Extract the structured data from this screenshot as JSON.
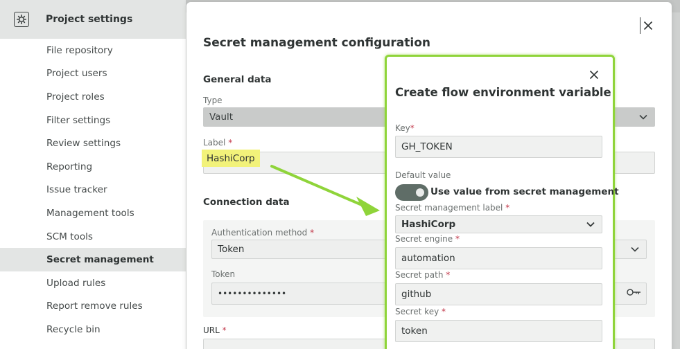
{
  "sidebar": {
    "title": "Project settings",
    "items": [
      {
        "label": "File repository"
      },
      {
        "label": "Project users"
      },
      {
        "label": "Project roles"
      },
      {
        "label": "Filter settings"
      },
      {
        "label": "Review settings"
      },
      {
        "label": "Reporting"
      },
      {
        "label": "Issue tracker"
      },
      {
        "label": "Management tools"
      },
      {
        "label": "SCM tools"
      },
      {
        "label": "Secret management",
        "active": true
      },
      {
        "label": "Upload rules"
      },
      {
        "label": "Report remove rules"
      },
      {
        "label": "Recycle bin"
      }
    ]
  },
  "modal": {
    "title": "Secret management configuration",
    "general_title": "General data",
    "type_label": "Type",
    "type_value": "Vault",
    "label_label": "Label",
    "label_value": "HashiCorp",
    "connection_title": "Connection data",
    "auth_label": "Authentication method",
    "auth_value": "Token",
    "token_label": "Token",
    "token_value": "••••••••••••••",
    "url_label": "URL",
    "required_mark": "*"
  },
  "inner": {
    "title": "Create flow environment variable",
    "key_label": "Key",
    "key_value": "GH_TOKEN",
    "default_label": "Default value",
    "toggle_label": "Use value from secret management",
    "toggle_on": true,
    "sm_label_label": "Secret management label",
    "sm_label_value": "HashiCorp",
    "engine_label": "Secret engine",
    "engine_value": "automation",
    "path_label": "Secret path",
    "path_value": "github",
    "key2_label": "Secret key",
    "key2_value": "token"
  },
  "colors": {
    "highlight": "#f2f27a",
    "annotation_green": "#8fd43a",
    "required": "#c2384a"
  },
  "icons": {
    "sidebar_gear": "gear-icon",
    "close": "close-icon",
    "dropdown": "chevron-down-icon",
    "token_key": "key-icon"
  }
}
